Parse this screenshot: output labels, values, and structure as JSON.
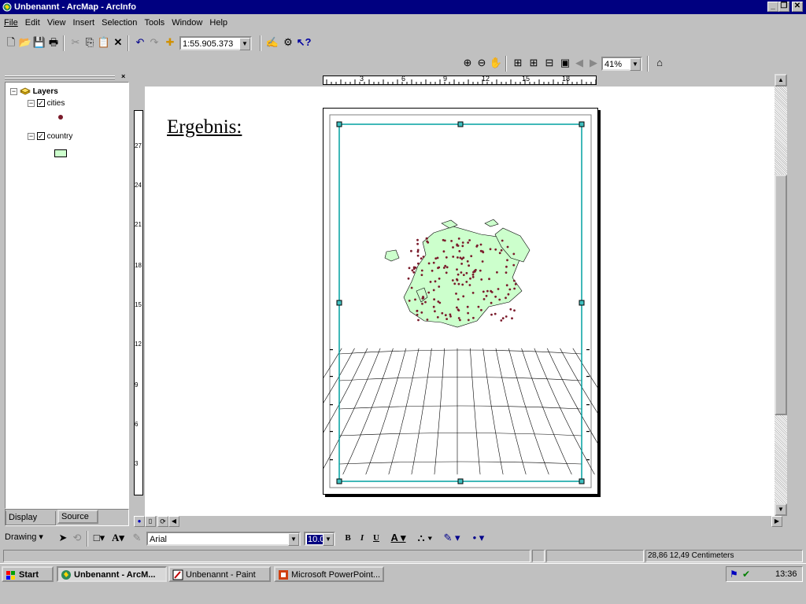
{
  "window": {
    "title": "Unbenannt - ArcMap - ArcInfo"
  },
  "menu": [
    "File",
    "Edit",
    "View",
    "Insert",
    "Selection",
    "Tools",
    "Window",
    "Help"
  ],
  "toolbar": {
    "scale": "1:55.905.373",
    "zoom": "41%"
  },
  "toc": {
    "root": "Layers",
    "layers": [
      {
        "name": "cities",
        "checked": true
      },
      {
        "name": "country",
        "checked": true
      }
    ],
    "tabs": [
      "Display",
      "Source"
    ]
  },
  "layout": {
    "heading": "Ergebnis:",
    "ruler_h": [
      "3",
      "6",
      "9",
      "12",
      "15",
      "18"
    ],
    "ruler_v": [
      "27",
      "24",
      "21",
      "18",
      "15",
      "12",
      "9",
      "6",
      "3"
    ]
  },
  "drawing": {
    "menu": "Drawing",
    "font": "Arial",
    "size": "10.0",
    "bold": "B",
    "italic": "I",
    "underline": "U"
  },
  "status": {
    "coords": "28,86  12,49 Centimeters"
  },
  "taskbar": {
    "start": "Start",
    "items": [
      "Unbenannt - ArcM...",
      "Unbenannt - Paint",
      "Microsoft PowerPoint..."
    ],
    "time": "13:36"
  },
  "colors": {
    "titlebar": "#000080",
    "country_fill": "#ccffcc",
    "city_point": "#7a1a2a",
    "frame_select": "#00a0a0"
  }
}
